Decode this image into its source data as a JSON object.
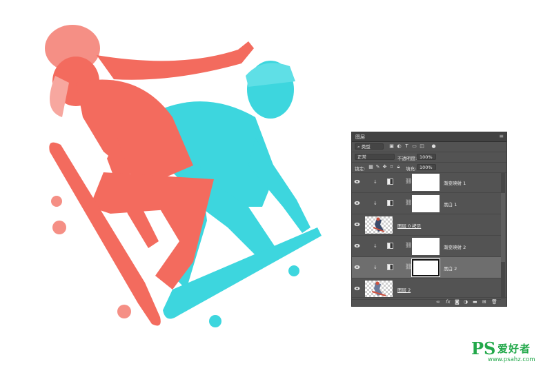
{
  "colors": {
    "red": "#f36b5e",
    "cyan": "#3dd6de",
    "panel_bg": "#535353",
    "panel_active": "#6e6e6e",
    "brand_green": "#22a84a"
  },
  "panel": {
    "title": "图层",
    "filter": {
      "kind_label": "类型",
      "icons": [
        "image-filter-icon",
        "adjustment-filter-icon",
        "type-filter-icon",
        "shape-filter-icon",
        "smart-object-filter-icon"
      ]
    },
    "blend_mode": "正常",
    "opacity_label": "不透明度:",
    "opacity_value": "100%",
    "lock_label": "锁定:",
    "fill_label": "填充:",
    "fill_value": "100%",
    "layers": [
      {
        "name": "渐变映射 1",
        "type": "adjustment",
        "clipped": true
      },
      {
        "name": "黑白 1",
        "type": "adjustment",
        "clipped": true
      },
      {
        "name": "图层 0 拷贝",
        "type": "pixel",
        "clipped": false
      },
      {
        "name": "渐变映射 2",
        "type": "adjustment",
        "clipped": true
      },
      {
        "name": "黑白 2",
        "type": "adjustment",
        "clipped": true,
        "active": true
      },
      {
        "name": "图层 2",
        "type": "pixel",
        "clipped": false
      }
    ],
    "footer_icons": [
      "link-icon",
      "fx-icon",
      "mask-icon",
      "adjustment-icon",
      "group-icon",
      "new-layer-icon",
      "delete-icon"
    ],
    "fx_label": "fx"
  },
  "watermark": {
    "ps": "PS",
    "cn": "爱好者",
    "url": "www.psahz.com"
  }
}
